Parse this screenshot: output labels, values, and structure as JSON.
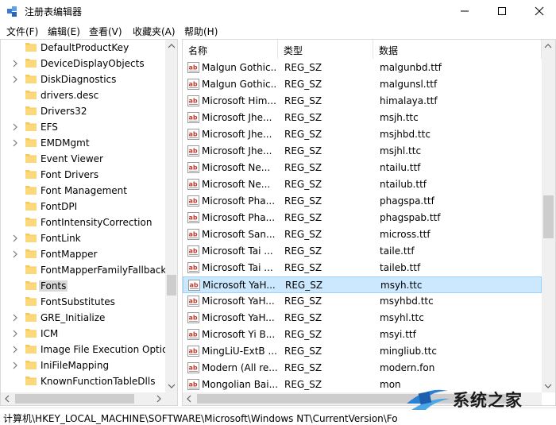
{
  "window": {
    "title": "注册表编辑器",
    "controls": {
      "minimize": "minimize-icon",
      "maximize": "maximize-icon",
      "close": "close-icon"
    }
  },
  "menu": [
    {
      "label": "文件(F)"
    },
    {
      "label": "编辑(E)"
    },
    {
      "label": "查看(V)"
    },
    {
      "label": "收藏夹(A)"
    },
    {
      "label": "帮助(H)"
    }
  ],
  "tree": {
    "items": [
      {
        "label": "DefaultProductKey",
        "expandable": false
      },
      {
        "label": "DeviceDisplayObjects",
        "expandable": true
      },
      {
        "label": "DiskDiagnostics",
        "expandable": true
      },
      {
        "label": "drivers.desc",
        "expandable": false
      },
      {
        "label": "Drivers32",
        "expandable": false
      },
      {
        "label": "EFS",
        "expandable": true
      },
      {
        "label": "EMDMgmt",
        "expandable": true
      },
      {
        "label": "Event Viewer",
        "expandable": false
      },
      {
        "label": "Font Drivers",
        "expandable": false
      },
      {
        "label": "Font Management",
        "expandable": false
      },
      {
        "label": "FontDPI",
        "expandable": false
      },
      {
        "label": "FontIntensityCorrection",
        "expandable": false
      },
      {
        "label": "FontLink",
        "expandable": true
      },
      {
        "label": "FontMapper",
        "expandable": true
      },
      {
        "label": "FontMapperFamilyFallback",
        "expandable": false
      },
      {
        "label": "Fonts",
        "expandable": false,
        "selected": true
      },
      {
        "label": "FontSubstitutes",
        "expandable": false
      },
      {
        "label": "GRE_Initialize",
        "expandable": true
      },
      {
        "label": "ICM",
        "expandable": true
      },
      {
        "label": "Image File Execution Optio",
        "expandable": true
      },
      {
        "label": "IniFileMapping",
        "expandable": true
      },
      {
        "label": "KnownFunctionTableDlls",
        "expandable": false
      }
    ]
  },
  "values": {
    "columns": {
      "name": "名称",
      "type": "类型",
      "data": "数据"
    },
    "rows": [
      {
        "name": "Malgun Gothic...",
        "type": "REG_SZ",
        "data": "malgunbd.ttf"
      },
      {
        "name": "Malgun Gothic...",
        "type": "REG_SZ",
        "data": "malgunsl.ttf"
      },
      {
        "name": "Microsoft Him...",
        "type": "REG_SZ",
        "data": "himalaya.ttf"
      },
      {
        "name": "Microsoft Jhe...",
        "type": "REG_SZ",
        "data": "msjh.ttc"
      },
      {
        "name": "Microsoft Jhe...",
        "type": "REG_SZ",
        "data": "msjhbd.ttc"
      },
      {
        "name": "Microsoft Jhe...",
        "type": "REG_SZ",
        "data": "msjhl.ttc"
      },
      {
        "name": "Microsoft Ne...",
        "type": "REG_SZ",
        "data": "ntailu.ttf"
      },
      {
        "name": "Microsoft Ne...",
        "type": "REG_SZ",
        "data": "ntailub.ttf"
      },
      {
        "name": "Microsoft Pha...",
        "type": "REG_SZ",
        "data": "phagspa.ttf"
      },
      {
        "name": "Microsoft Pha...",
        "type": "REG_SZ",
        "data": "phagspab.ttf"
      },
      {
        "name": "Microsoft San...",
        "type": "REG_SZ",
        "data": "micross.ttf"
      },
      {
        "name": "Microsoft Tai ...",
        "type": "REG_SZ",
        "data": "taile.ttf"
      },
      {
        "name": "Microsoft Tai ...",
        "type": "REG_SZ",
        "data": "taileb.ttf"
      },
      {
        "name": "Microsoft YaH...",
        "type": "REG_SZ",
        "data": "msyh.ttc",
        "selected": true
      },
      {
        "name": "Microsoft YaH...",
        "type": "REG_SZ",
        "data": "msyhbd.ttc"
      },
      {
        "name": "Microsoft YaH...",
        "type": "REG_SZ",
        "data": "msyhl.ttc"
      },
      {
        "name": "Microsoft Yi B...",
        "type": "REG_SZ",
        "data": "msyi.ttf"
      },
      {
        "name": "MingLiU-ExtB ...",
        "type": "REG_SZ",
        "data": "mingliub.ttc"
      },
      {
        "name": "Modern (All re...",
        "type": "REG_SZ",
        "data": "modern.fon"
      },
      {
        "name": "Mongolian Bai...",
        "type": "REG_SZ",
        "data": "mon"
      }
    ]
  },
  "status": {
    "path": "计算机\\HKEY_LOCAL_MACHINE\\SOFTWARE\\Microsoft\\Windows NT\\CurrentVersion\\Fo"
  },
  "watermark": {
    "text": "系统之家"
  },
  "colors": {
    "selection": "#cce8ff",
    "selection_border": "#99d1ff",
    "folder": "#f6c95a",
    "ab_red": "#c0392b"
  }
}
